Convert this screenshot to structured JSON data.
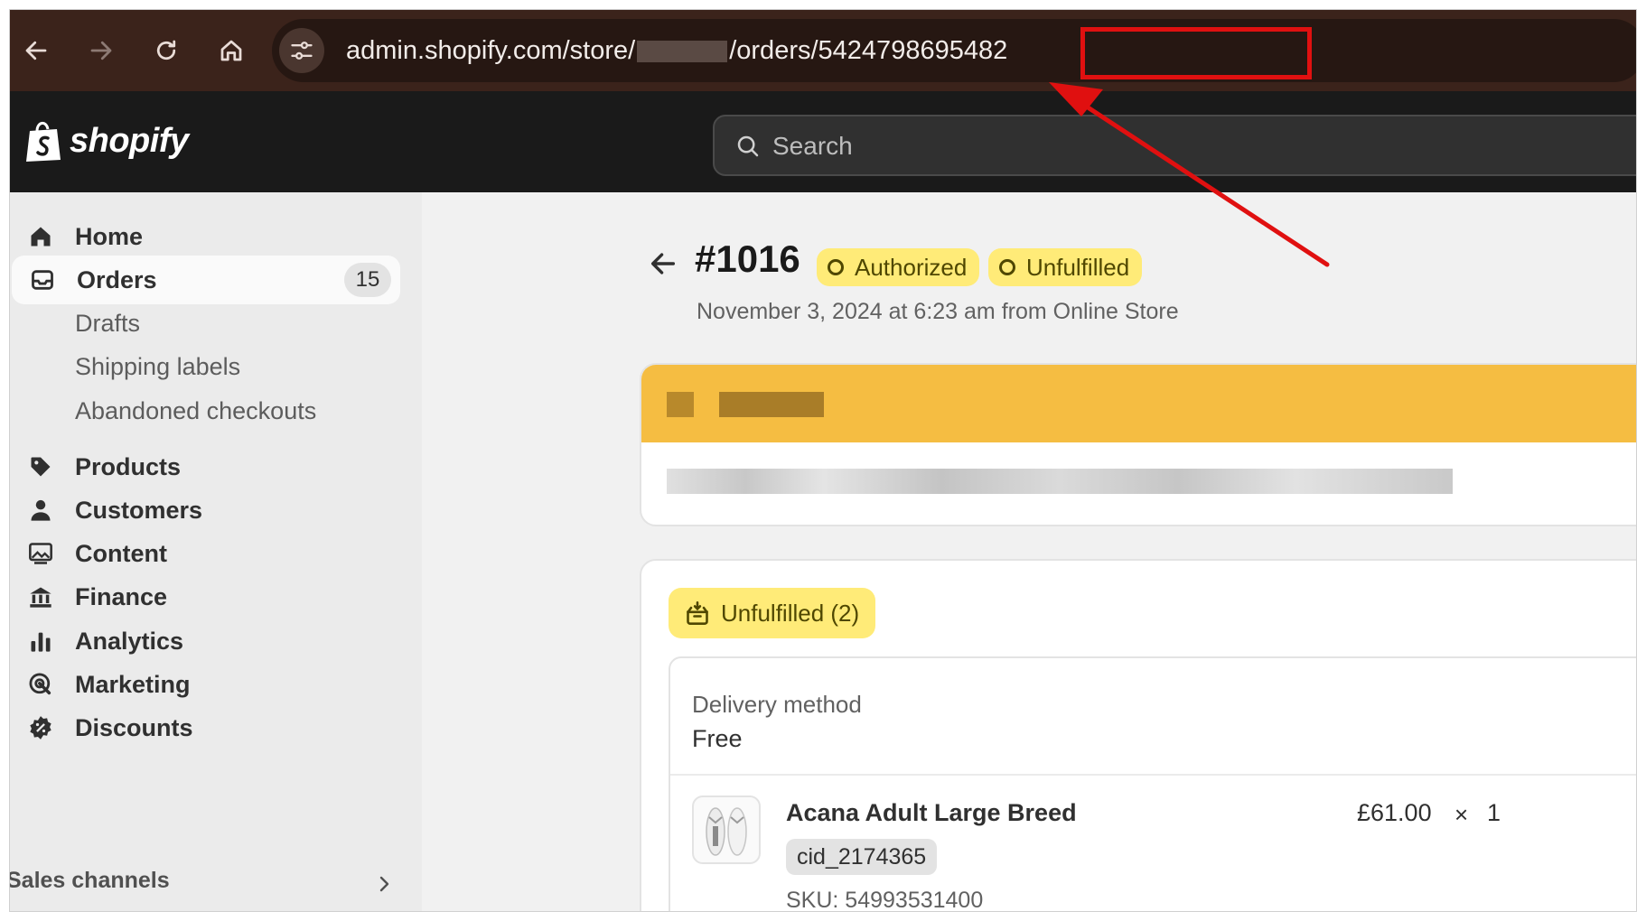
{
  "browser": {
    "url_prefix": "admin.shopify.com/store/",
    "url_middle": "/orders/",
    "url_order_id": "5424798695482"
  },
  "topbar": {
    "logo_text": "shopify",
    "search_placeholder": "Search"
  },
  "sidebar": {
    "items": [
      {
        "label": "Home",
        "icon": "home-icon"
      },
      {
        "label": "Orders",
        "icon": "orders-icon",
        "count": "15",
        "active": true
      },
      {
        "label": "Drafts"
      },
      {
        "label": "Shipping labels"
      },
      {
        "label": "Abandoned checkouts"
      },
      {
        "label": "Products",
        "icon": "tag-icon"
      },
      {
        "label": "Customers",
        "icon": "person-icon"
      },
      {
        "label": "Content",
        "icon": "image-icon"
      },
      {
        "label": "Finance",
        "icon": "bank-icon"
      },
      {
        "label": "Analytics",
        "icon": "bar-chart-icon"
      },
      {
        "label": "Marketing",
        "icon": "target-icon"
      },
      {
        "label": "Discounts",
        "icon": "discount-icon"
      }
    ],
    "sales_channels_label": "Sales channels"
  },
  "order": {
    "number": "#1016",
    "payment_status": "Authorized",
    "fulfillment_status": "Unfulfilled",
    "subtitle": "November 3, 2024 at 6:23 am from Online Store"
  },
  "fulfillment": {
    "badge": "Unfulfilled (2)",
    "delivery_label": "Delivery method",
    "delivery_value": "Free",
    "item": {
      "name": "Acana Adult Large Breed",
      "tag": "cid_2174365",
      "sku": "SKU: 54993531400",
      "price": "£61.00",
      "times": "×",
      "qty": "1"
    }
  },
  "colors": {
    "browser_bar": "#3b231b",
    "topbar": "#1a1a1a",
    "badge_yellow": "#ffeb78",
    "banner_orange": "#f5bd42",
    "annotation_red": "#e01010"
  }
}
